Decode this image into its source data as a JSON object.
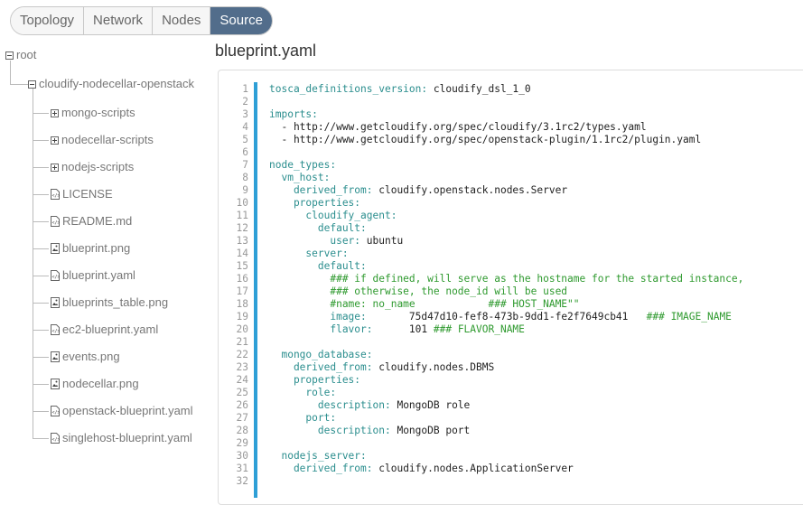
{
  "tabs": [
    {
      "label": "Topology",
      "active": false
    },
    {
      "label": "Network",
      "active": false
    },
    {
      "label": "Nodes",
      "active": false
    },
    {
      "label": "Source",
      "active": true
    }
  ],
  "tree": {
    "root": "root",
    "project": "cloudify-nodecellar-openstack",
    "folders": [
      "mongo-scripts",
      "nodecellar-scripts",
      "nodejs-scripts"
    ],
    "files": [
      {
        "name": "LICENSE",
        "icon": "code-file-icon"
      },
      {
        "name": "README.md",
        "icon": "code-file-icon"
      },
      {
        "name": "blueprint.png",
        "icon": "image-file-icon"
      },
      {
        "name": "blueprint.yaml",
        "icon": "code-file-icon"
      },
      {
        "name": "blueprints_table.png",
        "icon": "image-file-icon"
      },
      {
        "name": "ec2-blueprint.yaml",
        "icon": "code-file-icon"
      },
      {
        "name": "events.png",
        "icon": "image-file-icon"
      },
      {
        "name": "nodecellar.png",
        "icon": "image-file-icon"
      },
      {
        "name": "openstack-blueprint.yaml",
        "icon": "code-file-icon"
      },
      {
        "name": "singlehost-blueprint.yaml",
        "icon": "code-file-icon"
      }
    ]
  },
  "file_title": "blueprint.yaml",
  "code_lines": [
    [
      [
        "k",
        "tosca_definitions_version:"
      ],
      [
        "v",
        " cloudify_dsl_1_0"
      ]
    ],
    [],
    [
      [
        "k",
        "imports:"
      ]
    ],
    [
      [
        "v",
        "  - http://www.getcloudify.org/spec/cloudify/3.1rc2/types.yaml"
      ]
    ],
    [
      [
        "v",
        "  - http://www.getcloudify.org/spec/openstack-plugin/1.1rc2/plugin.yaml"
      ]
    ],
    [],
    [
      [
        "k",
        "node_types:"
      ]
    ],
    [
      [
        "k",
        "  vm_host:"
      ]
    ],
    [
      [
        "k",
        "    derived_from:"
      ],
      [
        "v",
        " cloudify.openstack.nodes.Server"
      ]
    ],
    [
      [
        "k",
        "    properties:"
      ]
    ],
    [
      [
        "k",
        "      cloudify_agent:"
      ]
    ],
    [
      [
        "k",
        "        default:"
      ]
    ],
    [
      [
        "k",
        "          user:"
      ],
      [
        "v",
        " ubuntu"
      ]
    ],
    [
      [
        "k",
        "      server:"
      ]
    ],
    [
      [
        "k",
        "        default:"
      ]
    ],
    [
      [
        "c",
        "          ### if defined, will serve as the hostname for the started instance,"
      ]
    ],
    [
      [
        "c",
        "          ### otherwise, the node_id will be used"
      ]
    ],
    [
      [
        "c",
        "          #name: no_name            ### HOST_NAME\"\""
      ]
    ],
    [
      [
        "k",
        "          image:"
      ],
      [
        "v",
        "       75d47d10-fef8-473b-9dd1-fe2f7649cb41   "
      ],
      [
        "c",
        "### IMAGE_NAME"
      ]
    ],
    [
      [
        "k",
        "          flavor:"
      ],
      [
        "v",
        "      101 "
      ],
      [
        "c",
        "### FLAVOR_NAME"
      ]
    ],
    [],
    [
      [
        "k",
        "  mongo_database:"
      ]
    ],
    [
      [
        "k",
        "    derived_from:"
      ],
      [
        "v",
        " cloudify.nodes.DBMS"
      ]
    ],
    [
      [
        "k",
        "    properties:"
      ]
    ],
    [
      [
        "k",
        "      role:"
      ]
    ],
    [
      [
        "k",
        "        description:"
      ],
      [
        "v",
        " MongoDB role"
      ]
    ],
    [
      [
        "k",
        "      port:"
      ]
    ],
    [
      [
        "k",
        "        description:"
      ],
      [
        "v",
        " MongoDB port"
      ]
    ],
    [],
    [
      [
        "k",
        "  nodejs_server:"
      ]
    ],
    [
      [
        "k",
        "    derived_from:"
      ],
      [
        "v",
        " cloudify.nodes.ApplicationServer"
      ]
    ],
    []
  ]
}
